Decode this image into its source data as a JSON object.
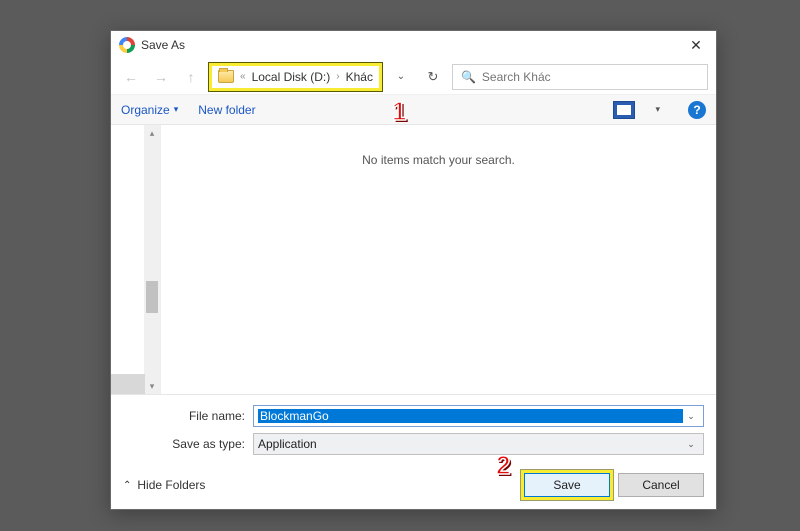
{
  "dialog": {
    "title": "Save As",
    "close_label": "✕"
  },
  "nav": {
    "back_icon": "←",
    "forward_icon": "→",
    "up_icon": "↑",
    "breadcrumb_prefix": "«",
    "breadcrumb_parent": "Local Disk (D:)",
    "breadcrumb_sep": "›",
    "breadcrumb_current": "Khác",
    "dropdown_caret": "⌄",
    "refresh_icon": "↻"
  },
  "search": {
    "icon": "🔍",
    "placeholder": "Search Khác"
  },
  "toolbar": {
    "organize_label": "Organize",
    "organize_caret": "▾",
    "newfolder_label": "New folder",
    "view_caret": "▾",
    "help_label": "?"
  },
  "content": {
    "empty_message": "No items match your search."
  },
  "fields": {
    "filename_label": "File name:",
    "filename_value": "BlockmanGo",
    "type_label": "Save as type:",
    "type_value": "Application",
    "caret": "⌄"
  },
  "footer": {
    "hide_caret": "⌃",
    "hide_label": "Hide Folders",
    "save_label": "Save",
    "cancel_label": "Cancel"
  },
  "callouts": {
    "one": "1",
    "two": "2"
  }
}
